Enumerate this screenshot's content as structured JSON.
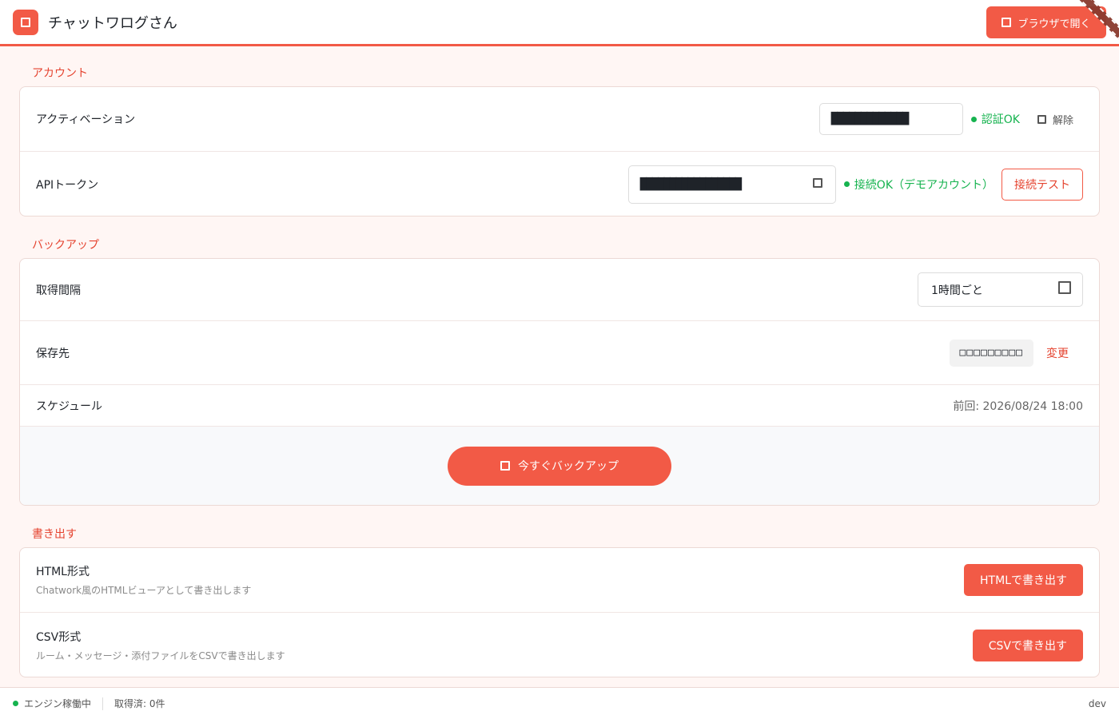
{
  "header": {
    "title": "チャットワログさん",
    "open_browser_label": "ブラウザで開く"
  },
  "account": {
    "section_title": "アカウント",
    "activation": {
      "label": "アクティベーション",
      "value": "█████████████",
      "status": "認証OK",
      "release_label": "解除"
    },
    "api_token": {
      "label": "APIトークン",
      "value": "█████████████████",
      "status": "接続OK（デモアカウント）",
      "test_label": "接続テスト"
    }
  },
  "backup": {
    "section_title": "バックアップ",
    "interval": {
      "label": "取得間隔",
      "selected": "1時間ごと"
    },
    "destination": {
      "label": "保存先",
      "path": "□□□□□□□□□",
      "change_label": "変更"
    },
    "schedule": {
      "label": "スケジュール",
      "last_run": "前回: 2026/08/24 18:00"
    },
    "backup_now_label": "今すぐバックアップ"
  },
  "export": {
    "section_title": "書き出す",
    "html": {
      "label": "HTML形式",
      "description": "Chatwork風のHTMLビューアとして書き出します",
      "button_label": "HTMLで書き出す"
    },
    "csv": {
      "label": "CSV形式",
      "description": "ルーム・メッセージ・添付ファイルをCSVで書き出します",
      "button_label": "CSVで書き出す"
    }
  },
  "footer": {
    "engine_status": "エンジン稼働中",
    "fetched": "取得済: 0件",
    "env": "dev"
  },
  "colors": {
    "accent": "#f25a46",
    "ok": "#16b34f",
    "background": "#fff6f4"
  }
}
